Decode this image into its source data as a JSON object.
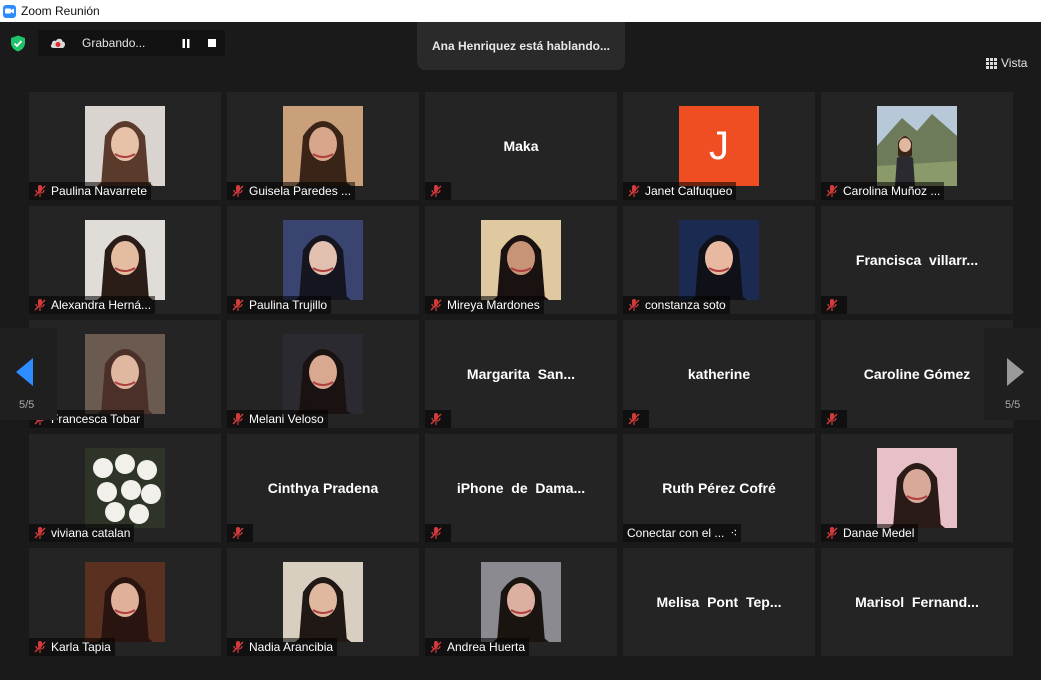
{
  "window": {
    "title": "Zoom Reunión"
  },
  "recording": {
    "label": "Grabando..."
  },
  "speaker_banner": "Ana Henriquez está hablando...",
  "view": {
    "label": "Vista"
  },
  "pagination": {
    "prev_label": "5/5",
    "next_label": "5/5"
  },
  "colors": {
    "accent": "#2d8cff",
    "shield": "#1ec46b",
    "muted": "#d33b3b",
    "avatar_j": "#ef4e22"
  },
  "participants": [
    {
      "name": "Paulina Navarrete",
      "video": "photo",
      "muted": true
    },
    {
      "name": "Guisela Paredes ...",
      "video": "photo",
      "muted": true
    },
    {
      "name": "",
      "center": "Maka",
      "video": "none",
      "muted": true
    },
    {
      "name": "Janet Calfuqueo",
      "video": "avatar",
      "avatar_letter": "J",
      "muted": true
    },
    {
      "name": "Carolina Muñoz ...",
      "video": "photo",
      "muted": true
    },
    {
      "name": "Alexandra Herná...",
      "video": "photo",
      "muted": true
    },
    {
      "name": "Paulina Trujillo",
      "video": "photo",
      "muted": true
    },
    {
      "name": "Mireya Mardones",
      "video": "photo",
      "muted": true
    },
    {
      "name": "constanza soto",
      "video": "photo",
      "muted": true
    },
    {
      "name": "",
      "center": "Francisca  villarr...",
      "video": "none",
      "muted": true
    },
    {
      "name": "Francesca Tobar",
      "video": "photo",
      "muted": true
    },
    {
      "name": "Melani Veloso",
      "video": "photo",
      "muted": true
    },
    {
      "name": "",
      "center": "Margarita  San...",
      "video": "none",
      "muted": true
    },
    {
      "name": "",
      "center": "katherine",
      "video": "none",
      "muted": true
    },
    {
      "name": "",
      "center": "Caroline Gómez",
      "video": "none",
      "muted": true
    },
    {
      "name": "viviana catalan",
      "video": "photo",
      "muted": true
    },
    {
      "name": "",
      "center": "Cinthya Pradena",
      "video": "none",
      "muted": true
    },
    {
      "name": "",
      "center": "iPhone  de  Dama...",
      "video": "none",
      "muted": true
    },
    {
      "name": "Conectar con el ...",
      "center": "Ruth Pérez Cofré",
      "video": "none",
      "muted": false,
      "connecting": true
    },
    {
      "name": "Danae Medel",
      "video": "photo",
      "muted": true
    },
    {
      "name": "Karla Tapia",
      "video": "photo",
      "muted": true
    },
    {
      "name": "Nadia Arancibia",
      "video": "photo",
      "muted": true
    },
    {
      "name": "Andrea Huerta",
      "video": "photo",
      "muted": true
    },
    {
      "name": "",
      "center": "Melisa  Pont  Tep...",
      "video": "none",
      "muted": false
    },
    {
      "name": "",
      "center": "Marisol  Fernand...",
      "video": "none",
      "muted": false
    }
  ]
}
